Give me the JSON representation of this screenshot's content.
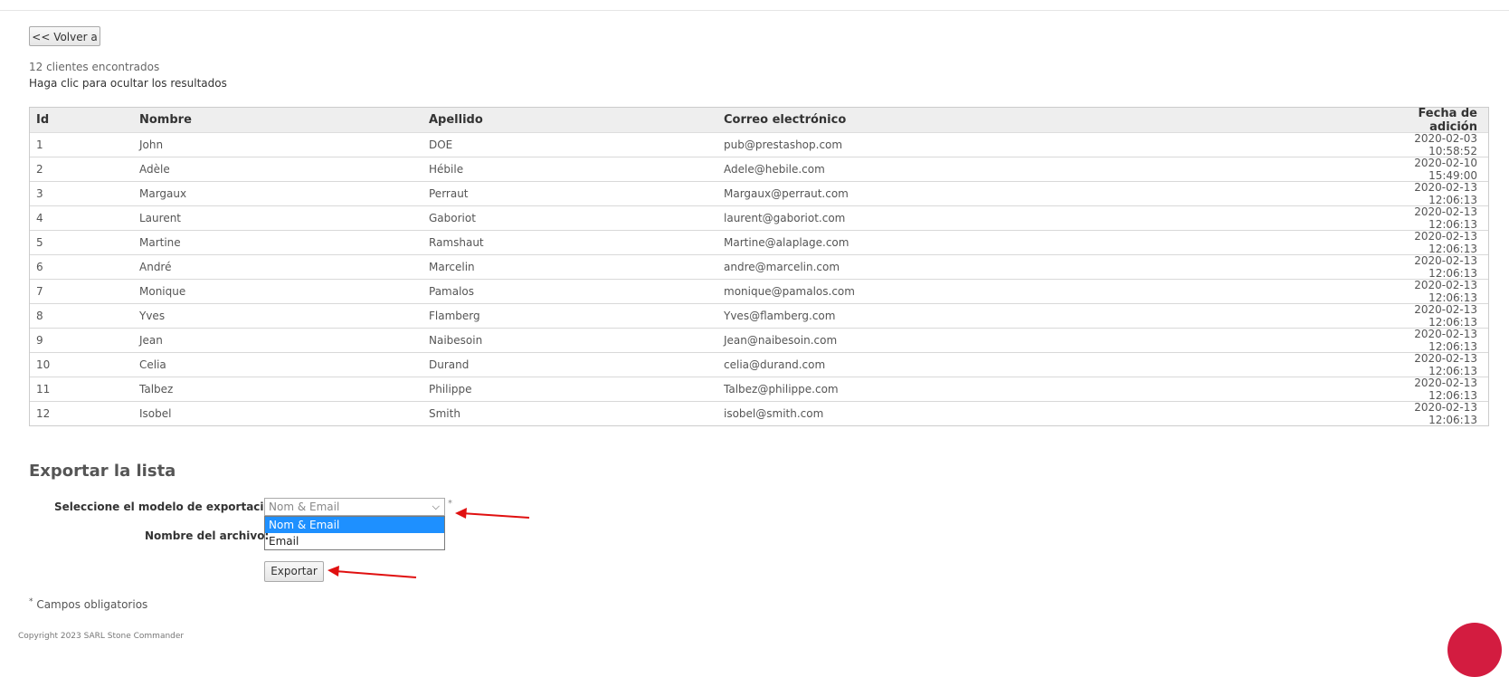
{
  "back_button": "<< Volver a",
  "results": {
    "count_text": "12 clientes encontrados",
    "toggle_text": "Haga clic para ocultar los resultados"
  },
  "table": {
    "headers": [
      "Id",
      "Nombre",
      "Apellido",
      "Correo electrónico",
      "Fecha de adición"
    ],
    "rows": [
      [
        "1",
        "John",
        "DOE",
        "pub@prestashop.com",
        "2020-02-03 10:58:52"
      ],
      [
        "2",
        "Adèle",
        "Hébile",
        "Adele@hebile.com",
        "2020-02-10 15:49:00"
      ],
      [
        "3",
        "Margaux",
        "Perraut",
        "Margaux@perraut.com",
        "2020-02-13 12:06:13"
      ],
      [
        "4",
        "Laurent",
        "Gaboriot",
        "laurent@gaboriot.com",
        "2020-02-13 12:06:13"
      ],
      [
        "5",
        "Martine",
        "Ramshaut",
        "Martine@alaplage.com",
        "2020-02-13 12:06:13"
      ],
      [
        "6",
        "André",
        "Marcelin",
        "andre@marcelin.com",
        "2020-02-13 12:06:13"
      ],
      [
        "7",
        "Monique",
        "Pamalos",
        "monique@pamalos.com",
        "2020-02-13 12:06:13"
      ],
      [
        "8",
        "Yves",
        "Flamberg",
        "Yves@flamberg.com",
        "2020-02-13 12:06:13"
      ],
      [
        "9",
        "Jean",
        "Naibesoin",
        "Jean@naibesoin.com",
        "2020-02-13 12:06:13"
      ],
      [
        "10",
        "Celia",
        "Durand",
        "celia@durand.com",
        "2020-02-13 12:06:13"
      ],
      [
        "11",
        "Talbez",
        "Philippe",
        "Talbez@philippe.com",
        "2020-02-13 12:06:13"
      ],
      [
        "12",
        "Isobel",
        "Smith",
        "isobel@smith.com",
        "2020-02-13 12:06:13"
      ]
    ]
  },
  "export": {
    "title": "Exportar la lista",
    "model_label": "Seleccione el modelo de exportación:",
    "model_selected": "Nom & Email",
    "model_options": [
      "Nom & Email",
      "Email"
    ],
    "required_marker": "*",
    "filename_label": "Nombre del archivo:",
    "export_button": "Exportar",
    "required_note": "Campos obligatorios"
  },
  "footer": {
    "copyright": "Copyright 2023 SARL Stone Commander"
  },
  "colors": {
    "selected_option_bg": "#1e90ff",
    "annotation_arrow": "#e01010",
    "chat_bubble": "#d31c40"
  }
}
